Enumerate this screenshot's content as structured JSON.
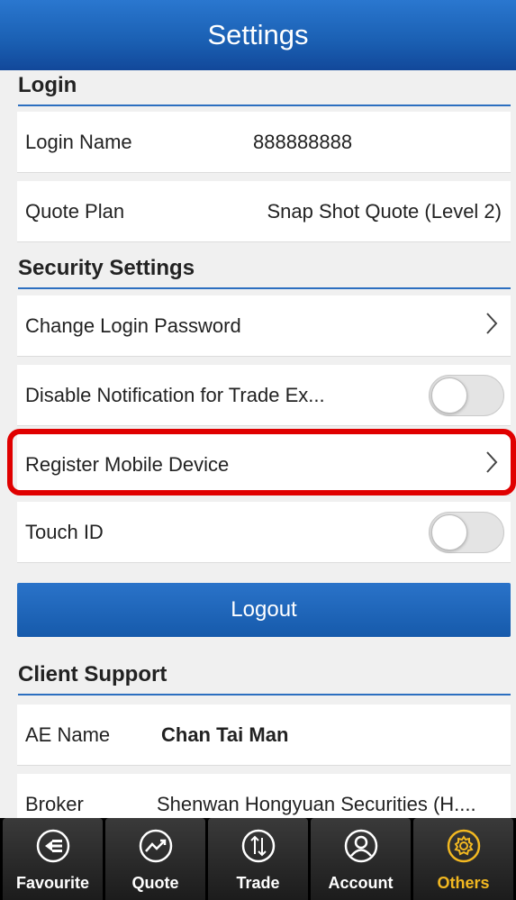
{
  "header": {
    "title": "Settings"
  },
  "login": {
    "section_title": "Login",
    "login_name_label": "Login Name",
    "login_name_value": "888888888",
    "quote_plan_label": "Quote Plan",
    "quote_plan_value": "Snap Shot Quote (Level 2)"
  },
  "security": {
    "section_title": "Security Settings",
    "change_password_label": "Change Login Password",
    "disable_notification_label": "Disable Notification for Trade Ex...",
    "disable_notification_on": false,
    "register_device_label": "Register Mobile Device",
    "touch_id_label": "Touch ID",
    "touch_id_on": false
  },
  "logout_label": "Logout",
  "support": {
    "section_title": "Client Support",
    "ae_name_label": "AE Name",
    "ae_name_value": "Chan Tai Man",
    "broker_label": "Broker",
    "broker_value": "Shenwan Hongyuan Securities (H...."
  },
  "tabs": [
    {
      "label": "Favourite",
      "icon": "favourite-icon",
      "active": false
    },
    {
      "label": "Quote",
      "icon": "quote-icon",
      "active": false
    },
    {
      "label": "Trade",
      "icon": "trade-icon",
      "active": false
    },
    {
      "label": "Account",
      "icon": "account-icon",
      "active": false
    },
    {
      "label": "Others",
      "icon": "others-gear-icon",
      "active": true
    }
  ],
  "colors": {
    "header_blue": "#1a5fb2",
    "highlight_red": "#e00000",
    "active_tab": "#f2b821"
  }
}
